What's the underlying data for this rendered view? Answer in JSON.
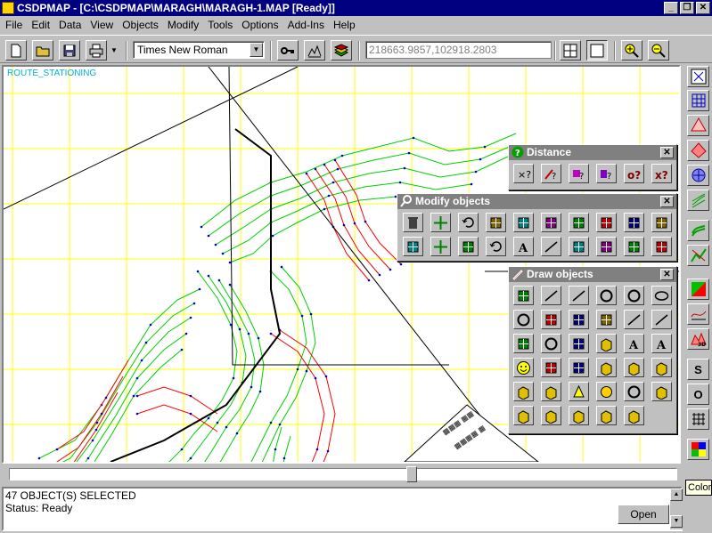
{
  "window": {
    "title": "CSDPMAP - [C:\\CSDPMAP\\MARAGH\\MARAGH-1.MAP [Ready]]"
  },
  "menu": [
    "File",
    "Edit",
    "Data",
    "View",
    "Objects",
    "Modify",
    "Tools",
    "Options",
    "Add-Ins",
    "Help"
  ],
  "toolbar": {
    "font_value": "Times New Roman",
    "coordinates": "218663.9857,102918.2803"
  },
  "map": {
    "layer_label": "ROUTE_STATIONING",
    "colors": {
      "grid": "#ffff00",
      "contour_green": "#00d000",
      "contour_red": "#ff0000",
      "route": "#000000"
    }
  },
  "contours": {
    "green": [
      [
        [
          222,
          180
        ],
        [
          260,
          150
        ],
        [
          300,
          130
        ],
        [
          340,
          118
        ],
        [
          380,
          100
        ],
        [
          420,
          90
        ],
        [
          460,
          80
        ],
        [
          500,
          95
        ],
        [
          540,
          90
        ],
        [
          575,
          75
        ]
      ],
      [
        [
          230,
          190
        ],
        [
          265,
          165
        ],
        [
          300,
          145
        ],
        [
          335,
          133
        ],
        [
          375,
          115
        ],
        [
          415,
          105
        ],
        [
          455,
          97
        ],
        [
          495,
          110
        ],
        [
          535,
          104
        ],
        [
          572,
          88
        ]
      ],
      [
        [
          238,
          200
        ],
        [
          270,
          180
        ],
        [
          300,
          160
        ],
        [
          333,
          148
        ],
        [
          370,
          130
        ],
        [
          410,
          120
        ],
        [
          450,
          114
        ],
        [
          490,
          124
        ],
        [
          530,
          118
        ],
        [
          568,
          100
        ]
      ],
      [
        [
          246,
          210
        ],
        [
          275,
          195
        ],
        [
          300,
          175
        ],
        [
          330,
          162
        ],
        [
          365,
          145
        ],
        [
          405,
          135
        ],
        [
          445,
          130
        ],
        [
          485,
          138
        ],
        [
          525,
          132
        ]
      ],
      [
        [
          254,
          220
        ],
        [
          280,
          210
        ],
        [
          302,
          190
        ],
        [
          328,
          176
        ],
        [
          360,
          160
        ],
        [
          400,
          150
        ],
        [
          440,
          146
        ],
        [
          480,
          152
        ],
        [
          520,
          146
        ]
      ],
      [
        [
          218,
          230
        ],
        [
          240,
          260
        ],
        [
          255,
          290
        ],
        [
          262,
          320
        ],
        [
          258,
          350
        ],
        [
          245,
          375
        ],
        [
          230,
          395
        ],
        [
          214,
          412
        ],
        [
          200,
          430
        ],
        [
          175,
          455
        ],
        [
          150,
          480
        ],
        [
          130,
          500
        ],
        [
          118,
          520
        ]
      ],
      [
        [
          230,
          235
        ],
        [
          250,
          265
        ],
        [
          265,
          295
        ],
        [
          272,
          325
        ],
        [
          268,
          355
        ],
        [
          255,
          380
        ],
        [
          240,
          400
        ],
        [
          225,
          420
        ],
        [
          210,
          440
        ],
        [
          186,
          465
        ],
        [
          160,
          490
        ],
        [
          140,
          515
        ]
      ],
      [
        [
          242,
          240
        ],
        [
          260,
          270
        ],
        [
          275,
          300
        ],
        [
          282,
          330
        ],
        [
          278,
          360
        ],
        [
          265,
          385
        ],
        [
          250,
          405
        ],
        [
          236,
          428
        ],
        [
          222,
          450
        ],
        [
          196,
          475
        ],
        [
          170,
          500
        ],
        [
          155,
          520
        ]
      ],
      [
        [
          254,
          245
        ],
        [
          272,
          275
        ],
        [
          286,
          305
        ],
        [
          292,
          335
        ],
        [
          288,
          365
        ],
        [
          276,
          390
        ],
        [
          262,
          412
        ],
        [
          248,
          436
        ],
        [
          234,
          460
        ],
        [
          208,
          485
        ],
        [
          182,
          510
        ]
      ],
      [
        [
          300,
          230
        ],
        [
          320,
          250
        ],
        [
          335,
          280
        ],
        [
          340,
          310
        ],
        [
          330,
          340
        ],
        [
          318,
          370
        ],
        [
          300,
          400
        ],
        [
          285,
          430
        ],
        [
          270,
          460
        ],
        [
          260,
          480
        ],
        [
          250,
          500
        ]
      ],
      [
        [
          312,
          225
        ],
        [
          332,
          248
        ],
        [
          345,
          278
        ],
        [
          350,
          310
        ],
        [
          340,
          342
        ],
        [
          328,
          372
        ],
        [
          310,
          402
        ],
        [
          296,
          432
        ],
        [
          282,
          462
        ],
        [
          270,
          484
        ],
        [
          262,
          505
        ]
      ],
      [
        [
          40,
          440
        ],
        [
          80,
          420
        ],
        [
          110,
          380
        ],
        [
          140,
          330
        ],
        [
          165,
          290
        ],
        [
          195,
          262
        ],
        [
          220,
          250
        ]
      ],
      [
        [
          35,
          460
        ],
        [
          75,
          440
        ],
        [
          105,
          400
        ],
        [
          135,
          350
        ],
        [
          160,
          310
        ],
        [
          190,
          280
        ],
        [
          214,
          266
        ]
      ],
      [
        [
          30,
          480
        ],
        [
          70,
          460
        ],
        [
          100,
          420
        ],
        [
          130,
          372
        ],
        [
          155,
          330
        ],
        [
          185,
          298
        ],
        [
          210,
          282
        ]
      ],
      [
        [
          25,
          500
        ],
        [
          65,
          480
        ],
        [
          95,
          440
        ],
        [
          126,
          392
        ],
        [
          150,
          350
        ],
        [
          180,
          318
        ],
        [
          205,
          300
        ]
      ],
      [
        [
          20,
          520
        ],
        [
          60,
          500
        ],
        [
          92,
          460
        ],
        [
          122,
          412
        ],
        [
          146,
          370
        ],
        [
          176,
          338
        ],
        [
          200,
          318
        ]
      ],
      [
        [
          290,
          480
        ],
        [
          300,
          460
        ],
        [
          305,
          430
        ],
        [
          312,
          405
        ]
      ],
      [
        [
          300,
          490
        ],
        [
          310,
          470
        ],
        [
          315,
          440
        ],
        [
          322,
          415
        ]
      ]
    ],
    "red": [
      [
        [
          340,
          120
        ],
        [
          360,
          150
        ],
        [
          370,
          180
        ],
        [
          385,
          210
        ],
        [
          410,
          240
        ]
      ],
      [
        [
          350,
          115
        ],
        [
          372,
          148
        ],
        [
          382,
          178
        ],
        [
          398,
          206
        ],
        [
          422,
          234
        ]
      ],
      [
        [
          360,
          110
        ],
        [
          384,
          146
        ],
        [
          394,
          176
        ],
        [
          410,
          202
        ],
        [
          434,
          228
        ]
      ],
      [
        [
          372,
          105
        ],
        [
          396,
          144
        ],
        [
          406,
          174
        ],
        [
          422,
          198
        ],
        [
          446,
          222
        ]
      ],
      [
        [
          300,
          300
        ],
        [
          330,
          320
        ],
        [
          350,
          350
        ],
        [
          360,
          390
        ],
        [
          352,
          430
        ],
        [
          340,
          460
        ]
      ],
      [
        [
          310,
          296
        ],
        [
          340,
          316
        ],
        [
          362,
          348
        ],
        [
          372,
          390
        ],
        [
          364,
          432
        ],
        [
          352,
          462
        ]
      ],
      [
        [
          60,
          430
        ],
        [
          90,
          410
        ],
        [
          115,
          372
        ],
        [
          140,
          330
        ]
      ],
      [
        [
          54,
          448
        ],
        [
          84,
          428
        ],
        [
          110,
          390
        ],
        [
          134,
          348
        ]
      ],
      [
        [
          48,
          466
        ],
        [
          78,
          446
        ],
        [
          104,
          408
        ],
        [
          128,
          366
        ]
      ],
      [
        [
          150,
          370
        ],
        [
          180,
          360
        ],
        [
          210,
          370
        ],
        [
          240,
          390
        ]
      ],
      [
        [
          150,
          390
        ],
        [
          180,
          380
        ],
        [
          210,
          390
        ],
        [
          240,
          410
        ]
      ]
    ]
  },
  "palettes": {
    "distance": {
      "title": "Distance"
    },
    "modify": {
      "title": "Modify objects"
    },
    "draw": {
      "title": "Draw objects"
    }
  },
  "status": {
    "selection": "47 OBJECT(S) SELECTED",
    "state": "Status: Ready",
    "open_label": "Open"
  },
  "right_toolbar": {
    "letter_s": "S",
    "letter_o": "O"
  },
  "tooltip": "Color"
}
